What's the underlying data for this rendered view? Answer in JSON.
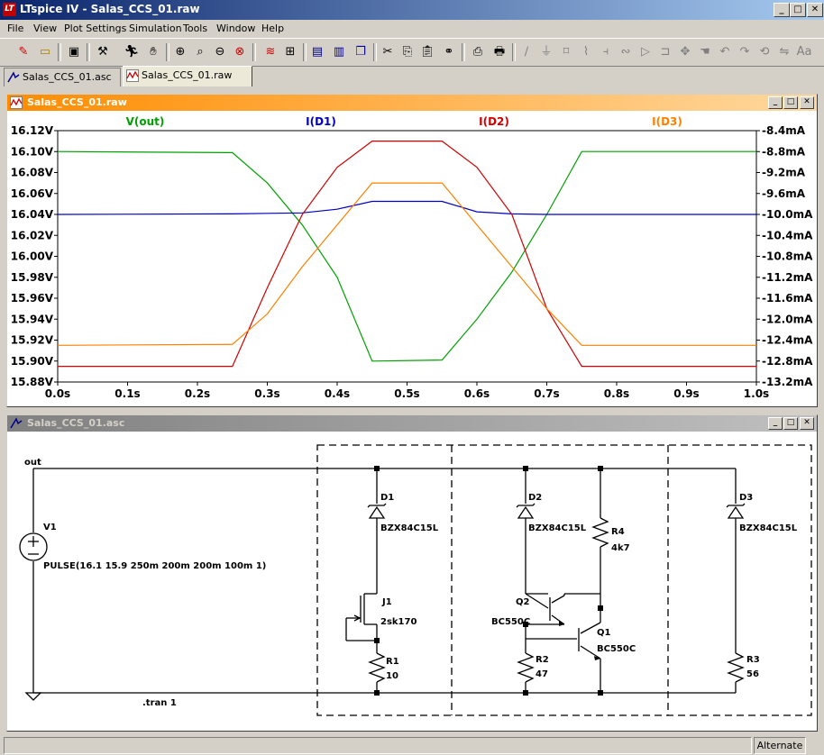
{
  "window": {
    "app_title": "LTspice IV - Salas_CCS_01.raw",
    "app_icon": "LT"
  },
  "menu": [
    "File",
    "View",
    "Plot Settings",
    "Simulation",
    "Tools",
    "Window",
    "Help"
  ],
  "toolbar_icons": [
    "new-schematic",
    "open",
    "save",
    "control-panel",
    "run",
    "halt",
    "zoom-in",
    "pan",
    "zoom-out",
    "zoom-full",
    "autorange",
    "tile-vertical",
    "tile-horizontal",
    "cascade",
    "cut",
    "copy",
    "paste",
    "find",
    "print-preview",
    "print",
    "draw-wire",
    "ground",
    "label-net",
    "resistor",
    "capacitor",
    "inductor",
    "diode",
    "component",
    "move",
    "drag",
    "undo",
    "redo",
    "rotate",
    "mirror",
    "text",
    "spice-directive"
  ],
  "tabs": [
    {
      "label": "Salas_CCS_01.asc",
      "active": false
    },
    {
      "label": "Salas_CCS_01.raw",
      "active": true
    }
  ],
  "plot_window": {
    "title": "Salas_CCS_01.raw"
  },
  "schematic_window": {
    "title": "Salas_CCS_01.asc"
  },
  "status": {
    "right": "Alternate"
  },
  "chart_data": {
    "type": "line",
    "xlabel": "",
    "x_ticks": [
      "0.0s",
      "0.1s",
      "0.2s",
      "0.3s",
      "0.4s",
      "0.5s",
      "0.6s",
      "0.7s",
      "0.8s",
      "0.9s",
      "1.0s"
    ],
    "xlim": [
      0,
      1.0
    ],
    "left_ticks": [
      "16.12V",
      "16.10V",
      "16.08V",
      "16.06V",
      "16.04V",
      "16.02V",
      "16.00V",
      "15.98V",
      "15.96V",
      "15.94V",
      "15.92V",
      "15.90V",
      "15.88V"
    ],
    "ylim_left": [
      15.88,
      16.12
    ],
    "right_ticks": [
      "-8.4mA",
      "-8.8mA",
      "-9.2mA",
      "-9.6mA",
      "-10.0mA",
      "-10.4mA",
      "-10.8mA",
      "-11.2mA",
      "-11.6mA",
      "-12.0mA",
      "-12.4mA",
      "-12.8mA",
      "-13.2mA"
    ],
    "ylim_right_mA": [
      -13.2,
      -8.4
    ],
    "grid": false,
    "legend": "top",
    "series": [
      {
        "name": "V(out)",
        "axis": "left",
        "color": "#00a000",
        "x": [
          0,
          0.25,
          0.3,
          0.35,
          0.4,
          0.45,
          0.55,
          0.6,
          0.65,
          0.7,
          0.75,
          1.0
        ],
        "y": [
          16.1,
          16.099,
          16.07,
          16.03,
          15.98,
          15.9,
          15.901,
          15.94,
          15.985,
          16.04,
          16.1,
          16.1
        ]
      },
      {
        "name": "I(D1)",
        "axis": "right",
        "color": "#0000c0",
        "x": [
          0,
          0.25,
          0.3,
          0.35,
          0.4,
          0.45,
          0.55,
          0.6,
          0.65,
          0.7,
          1.0
        ],
        "y": [
          -10.0,
          -9.99,
          -9.98,
          -9.97,
          -9.9,
          -9.75,
          -9.75,
          -9.95,
          -9.99,
          -10.0,
          -10.0
        ]
      },
      {
        "name": "I(D2)",
        "axis": "right",
        "color": "#d00000",
        "x": [
          0,
          0.25,
          0.28,
          0.3,
          0.35,
          0.4,
          0.45,
          0.55,
          0.6,
          0.65,
          0.7,
          0.75,
          1.0
        ],
        "y": [
          -12.9,
          -12.9,
          -12.0,
          -11.4,
          -10.0,
          -9.1,
          -8.6,
          -8.6,
          -9.1,
          -10.0,
          -11.8,
          -12.9,
          -12.9
        ]
      },
      {
        "name": "I(D3)",
        "axis": "right",
        "color": "#ff8000",
        "x": [
          0,
          0.25,
          0.3,
          0.35,
          0.4,
          0.45,
          0.55,
          0.6,
          0.65,
          0.7,
          0.75,
          1.0
        ],
        "y": [
          -12.5,
          -12.48,
          -11.9,
          -11.0,
          -10.2,
          -9.4,
          -9.4,
          -10.2,
          -11.0,
          -11.8,
          -12.5,
          -12.5
        ]
      }
    ]
  },
  "schematic": {
    "labels": {
      "net_out": "out",
      "v1_name": "V1",
      "v1_value": "PULSE(16.1 15.9 250m 200m 200m 100m 1)",
      "directive": ".tran 1",
      "d1_name": "D1",
      "d1_value": "BZX84C15L",
      "d2_name": "D2",
      "d2_value": "BZX84C15L",
      "d3_name": "D3",
      "d3_value": "BZX84C15L",
      "j1_name": "J1",
      "j1_value": "2sk170",
      "r1_name": "R1",
      "r1_value": "10",
      "r2_name": "R2",
      "r2_value": "47",
      "r3_name": "R3",
      "r3_value": "56",
      "r4_name": "R4",
      "r4_value": "4k7",
      "q1_name": "Q1",
      "q1_value": "BC550C",
      "q2_name": "Q2",
      "q2_value": "BC550C"
    }
  }
}
